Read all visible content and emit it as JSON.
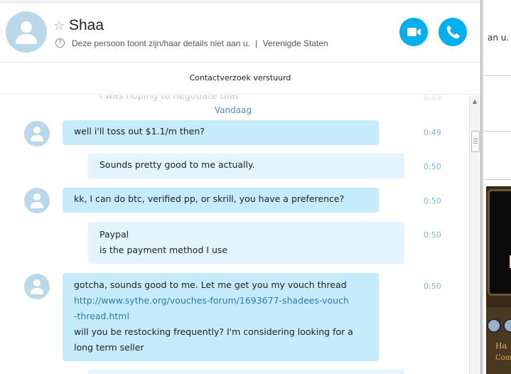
{
  "header": {
    "contact_name": "Shaa",
    "status_text": "Deze persoon toont zijn/haar details niet aan u.",
    "separator": "|",
    "location": "Verenigde Staten",
    "info_glyph": "?",
    "star_glyph": "☆"
  },
  "banner": {
    "text": "Contactverzoek verstuurd"
  },
  "chat": {
    "ghost_message": "I was hoping to negotiate that",
    "ghost_time": "0:49",
    "day_separator": "Vandaag",
    "messages": [
      {
        "direction": "incoming",
        "lines": [
          "well i'll toss out $1.1/m then?"
        ],
        "time": "0:49"
      },
      {
        "direction": "outgoing",
        "lines": [
          "Sounds pretty good to me actually."
        ],
        "time": "0:50"
      },
      {
        "direction": "incoming",
        "lines": [
          "kk, I can do btc, verified pp, or skrill, you have a preference?"
        ],
        "time": "0:50"
      },
      {
        "direction": "outgoing",
        "lines": [
          "Paypal",
          "is the payment method I use"
        ],
        "time": "0:50"
      },
      {
        "direction": "incoming",
        "lines": [
          "gotcha, sounds good to me. Let me get you my vouch thread"
        ],
        "link_lines": [
          "http://www.sythe.org/vouches-forum/1693677-shadees-vouch",
          "-thread.html"
        ],
        "after_lines": [
          "will you be restocking frequently? I'm considering looking for a",
          "long term seller"
        ],
        "time": "0:50"
      }
    ]
  },
  "right_pane": {
    "text": "an u.",
    "game_labels": [
      "Ha",
      "Com"
    ]
  },
  "icons": {
    "video_call": "video-camera-icon",
    "audio_call": "phone-icon",
    "avatar": "user-silhouette-icon"
  },
  "colors": {
    "accent": "#00aff0",
    "incoming_bubble": "#c6ebfa",
    "outgoing_bubble": "#e3f4fc",
    "link": "#2a7ab8",
    "timestamp": "#7fb5d3",
    "avatar_bg": "#b9d9ea"
  }
}
